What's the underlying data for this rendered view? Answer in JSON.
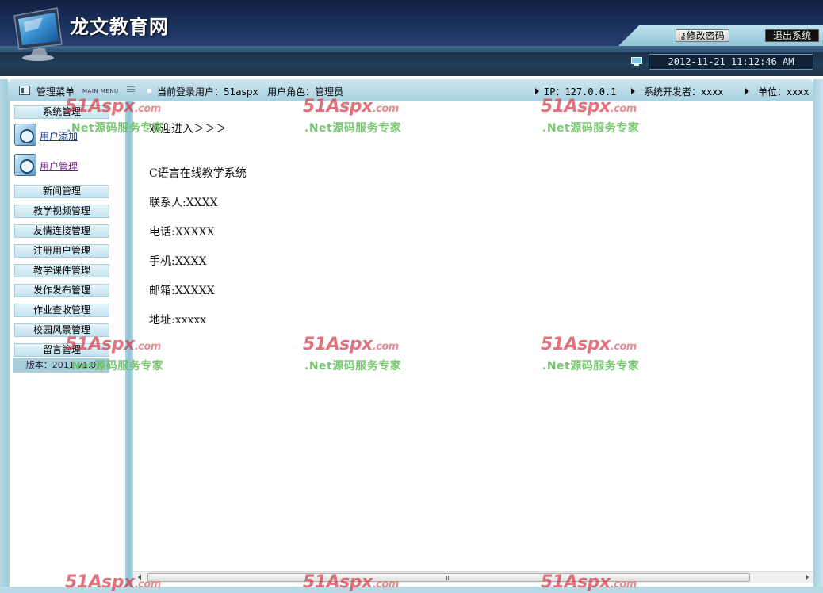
{
  "header": {
    "site_title": "龙文教育网",
    "change_password_label": "修改密码",
    "logout_label": "退出系统",
    "datetime": "2012-11-21 11:12:46 AM"
  },
  "infobar": {
    "menu_title": "管理菜单",
    "menu_subtitle": "MAIN MENU",
    "current_user": "当前登录用户：51aspx",
    "user_role": "用户角色：管理员",
    "ip": "IP：127.0.0.1",
    "developer": "系统开发者：xxxx",
    "unit": "单位：xxxx"
  },
  "sidebar": {
    "system_management": "系统管理",
    "sub_items": [
      {
        "label": "用户添加",
        "icon": "user-icon"
      },
      {
        "label": "用户管理",
        "icon": "gear-icon"
      }
    ],
    "items": [
      "新闻管理",
      "教学视频管理",
      "友情连接管理",
      "注册用户管理",
      "教学课件管理",
      "发作发布管理",
      "作业查收管理",
      "校园风景管理",
      "留言管理"
    ],
    "version": "版本：2011 v1.0"
  },
  "content": {
    "welcome": "欢迎进入＞＞＞",
    "system_name": "C语言在线教学系统",
    "contact": "联系人:XXXX",
    "phone": "电话:XXXXX",
    "mobile": "手机:XXXX",
    "email": "邮箱:XXXXX",
    "address": "地址:xxxxx"
  },
  "watermark": {
    "brand": "51Aspx",
    "domain": ".com",
    "slogan": ".Net源码服务专家"
  },
  "colors": {
    "header_dark": "#1c3460",
    "panel_light": "#a8d0de",
    "watermark_red": "#d63a4a",
    "watermark_green": "#60be58"
  }
}
